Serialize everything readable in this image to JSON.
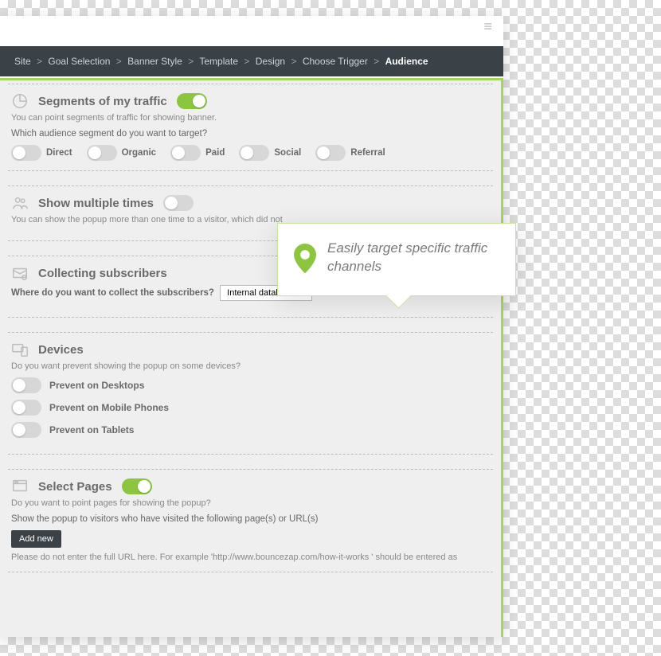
{
  "breadcrumb": {
    "items": [
      "Site",
      "Goal Selection",
      "Banner Style",
      "Template",
      "Design",
      "Choose Trigger",
      "Audience"
    ],
    "sep": ">"
  },
  "callout": {
    "text": "Easily target specific traffic channels"
  },
  "segments": {
    "title": "Segments of my traffic",
    "sub": "You can point segments of traffic for showing banner.",
    "question": "Which audience segment do you want to target?",
    "toggle_on": true,
    "options": [
      "Direct",
      "Organic",
      "Paid",
      "Social",
      "Referral"
    ]
  },
  "multiple": {
    "title": "Show multiple times",
    "sub": "You can show the popup more than one time to a visitor, which did not",
    "toggle_on": false
  },
  "subscribers": {
    "title": "Collecting subscribers",
    "question": "Where do you want to collect the subscribers?",
    "select_value": "Internal database"
  },
  "devices": {
    "title": "Devices",
    "question": "Do you want prevent showing the popup on some devices?",
    "options": [
      "Prevent on Desktops",
      "Prevent on Mobile Phones",
      "Prevent on Tablets"
    ]
  },
  "pages": {
    "title": "Select Pages",
    "question": "Do you want to point pages for showing the popup?",
    "toggle_on": true,
    "line": "Show the popup to visitors who have visited the following page(s) or URL(s)",
    "button": "Add new",
    "note": "Please do not enter the full URL here. For example 'http://www.bouncezap.com/how-it-works ' should be entered as"
  }
}
